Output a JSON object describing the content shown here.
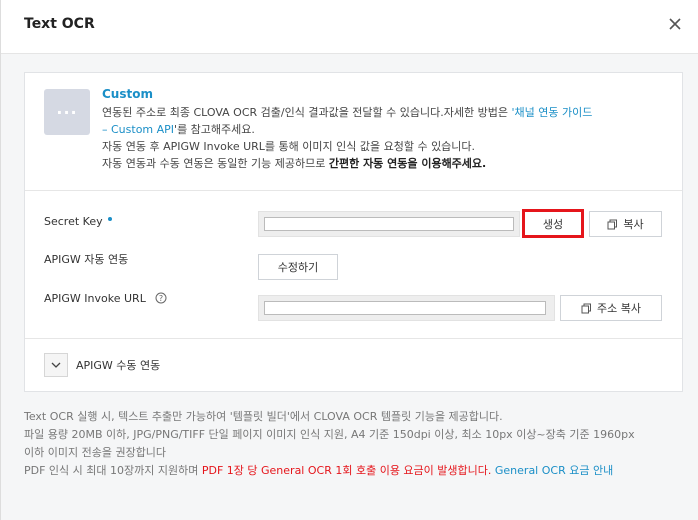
{
  "modal": {
    "title": "Text OCR",
    "close_label": "×"
  },
  "custom": {
    "icon_text": "···",
    "title": "Custom",
    "line1_a": "연동된 주소로 최종 CLOVA OCR 검출/인식 결과값을 전달할 수 있습니다.자세한 방법은 ",
    "line1_link": "'채널 연동 가이드",
    "line2_link": "– Custom API",
    "line2_b": "'를 참고해주세요.",
    "line3": "자동 연동 후 APIGW Invoke URL를 통해 이미지 인식 값을 요청할 수 있습니다.",
    "line4_a": "자동 연동과 수동 연동은 동일한 기능 제공하므로 ",
    "line4_bold": "간편한 자동 연동을 이용해주세요."
  },
  "secret_key": {
    "label": "Secret Key",
    "value": "",
    "generate_label": "생성",
    "copy_label": "복사"
  },
  "apigw_auto": {
    "label": "APIGW 자동 연동",
    "edit_label": "수정하기"
  },
  "invoke_url": {
    "label": "APIGW Invoke URL",
    "value": "",
    "copy_label": "주소 복사"
  },
  "manual": {
    "label": "APIGW 수동 연동"
  },
  "notes": {
    "line1": "Text OCR 실행 시, 텍스트 추출만 가능하여 '템플릿 빌더'에서 CLOVA OCR 템플릿 기능을 제공합니다.",
    "line2": "파일 용량 20MB 이하, JPG/PNG/TIFF 단일 페이지 이미지 인식 지원, A4 기준 150dpi 이상, 최소 10px 이상~장축 기준 1960px",
    "line3": "이하 이미지 전송을 권장합니다",
    "line4_a": "PDF 인식 시 최대 10장까지 지원하며 ",
    "line4_red": "PDF 1장 당 General OCR 1회 호출 이용 요금이 발생합니다.",
    "line4_link": " General OCR 요금 안내"
  },
  "colors": {
    "accent": "#1b8fc7",
    "alert": "#e5151b"
  }
}
